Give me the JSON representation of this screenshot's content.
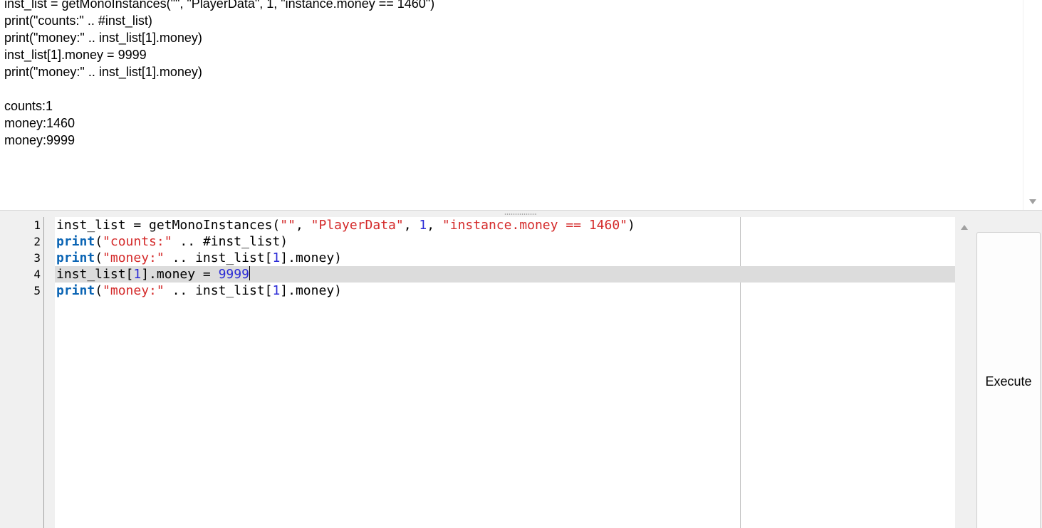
{
  "output": {
    "lines": [
      "inst_list = getMonoInstances(\"\", \"PlayerData\", 1, \"instance.money == 1460\")",
      "print(\"counts:\" .. #inst_list)",
      "print(\"money:\" .. inst_list[1].money)",
      "inst_list[1].money = 9999",
      "print(\"money:\" .. inst_list[1].money)",
      "",
      "counts:1",
      "money:1460",
      "money:9999"
    ]
  },
  "editor": {
    "line_numbers": [
      "1",
      "2",
      "3",
      "4",
      "5"
    ],
    "current_line": 4,
    "code": [
      [
        {
          "t": "inst_list = getMonoInstances(",
          "c": ""
        },
        {
          "t": "\"\"",
          "c": "str"
        },
        {
          "t": ", ",
          "c": ""
        },
        {
          "t": "\"PlayerData\"",
          "c": "str"
        },
        {
          "t": ", ",
          "c": ""
        },
        {
          "t": "1",
          "c": "num"
        },
        {
          "t": ", ",
          "c": ""
        },
        {
          "t": "\"instance.money == 1460\"",
          "c": "str"
        },
        {
          "t": ")",
          "c": ""
        }
      ],
      [
        {
          "t": "print",
          "c": "kw"
        },
        {
          "t": "(",
          "c": ""
        },
        {
          "t": "\"counts:\"",
          "c": "str"
        },
        {
          "t": " .. #inst_list)",
          "c": ""
        }
      ],
      [
        {
          "t": "print",
          "c": "kw"
        },
        {
          "t": "(",
          "c": ""
        },
        {
          "t": "\"money:\"",
          "c": "str"
        },
        {
          "t": " .. inst_list[",
          "c": ""
        },
        {
          "t": "1",
          "c": "num"
        },
        {
          "t": "].money)",
          "c": ""
        }
      ],
      [
        {
          "t": "inst_list[",
          "c": ""
        },
        {
          "t": "1",
          "c": "num"
        },
        {
          "t": "].money = ",
          "c": ""
        },
        {
          "t": "9999",
          "c": "num"
        }
      ],
      [
        {
          "t": "print",
          "c": "kw"
        },
        {
          "t": "(",
          "c": ""
        },
        {
          "t": "\"money:\"",
          "c": "str"
        },
        {
          "t": " .. inst_list[",
          "c": ""
        },
        {
          "t": "1",
          "c": "num"
        },
        {
          "t": "].money)",
          "c": ""
        }
      ]
    ]
  },
  "execute_button": {
    "label": "Execute"
  },
  "colors": {
    "keyword": "#0a64b4",
    "string": "#d42a2a",
    "number": "#2b2bd6",
    "current_line_bg": "#dcdcdc"
  },
  "icons": {
    "output_scroll_down": "scroll-down-arrow-icon",
    "editor_scroll_up": "scroll-up-arrow-icon"
  }
}
